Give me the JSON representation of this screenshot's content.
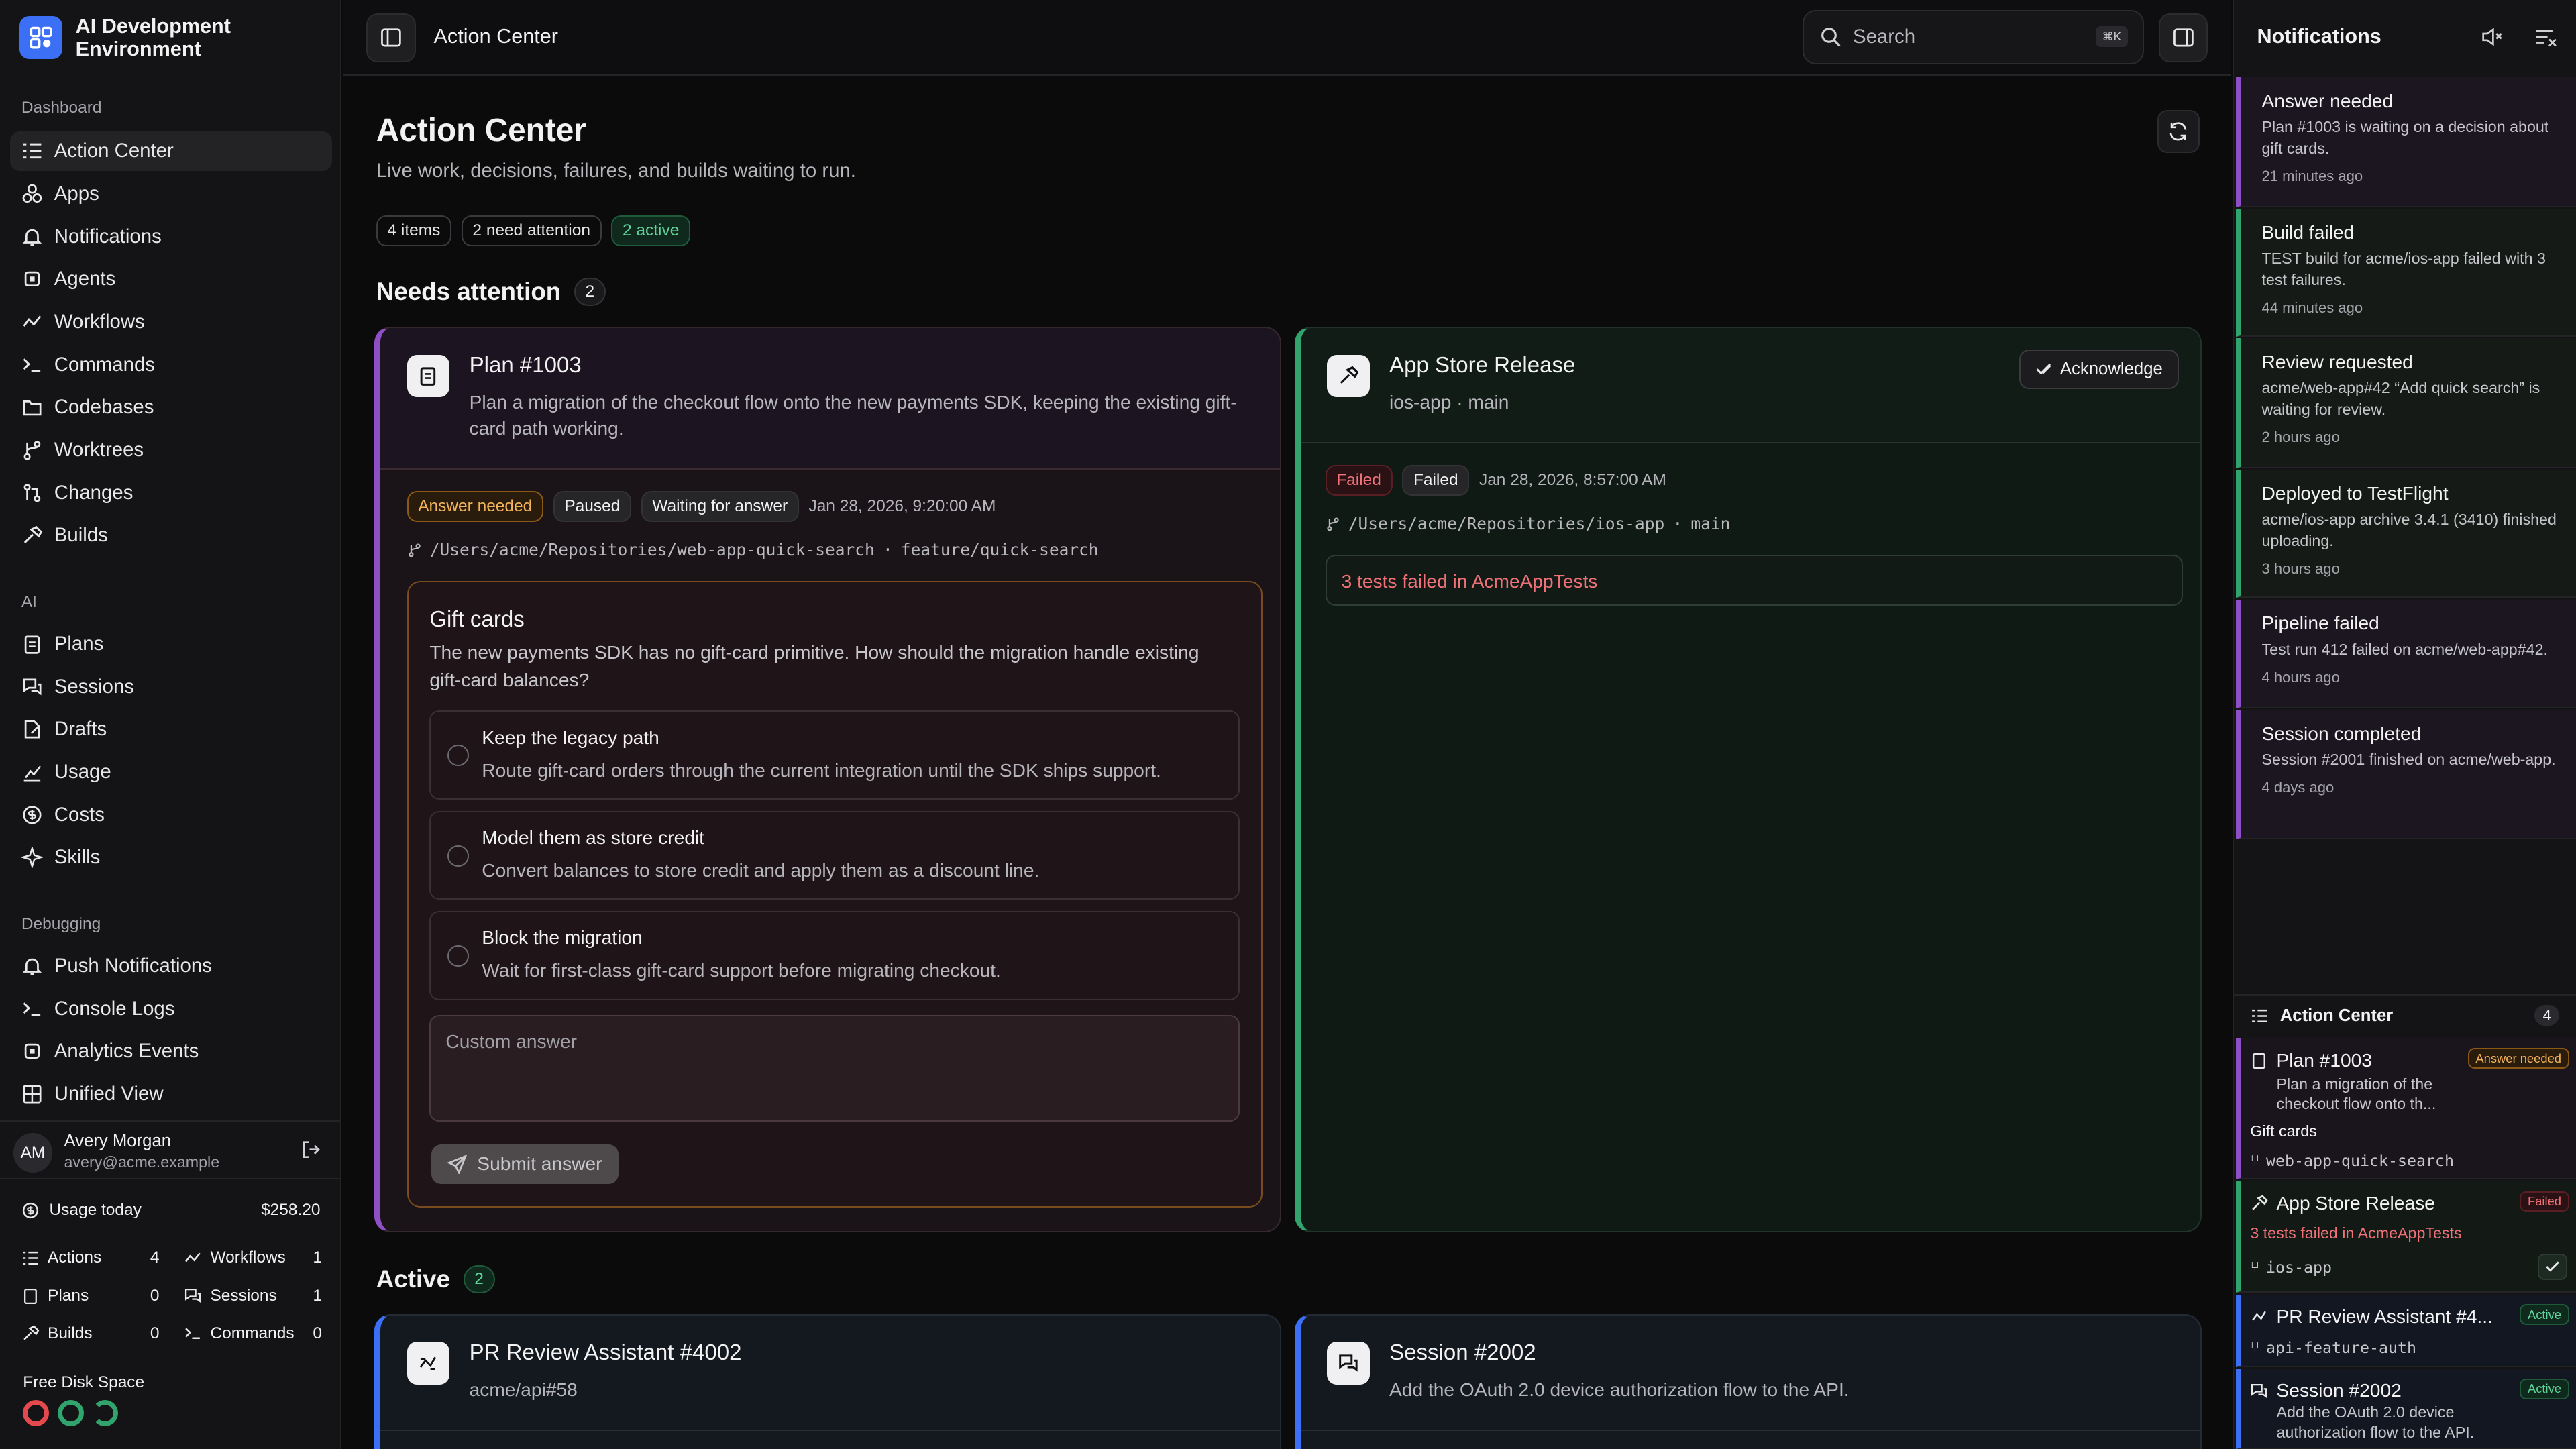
{
  "app": {
    "name": "AI Development Environment"
  },
  "sidebar": {
    "sections": [
      {
        "label": "Dashboard",
        "items": [
          {
            "label": "Action Center",
            "icon": "list-icon"
          },
          {
            "label": "Apps",
            "icon": "apps-icon"
          },
          {
            "label": "Notifications",
            "icon": "bell-icon"
          },
          {
            "label": "Agents",
            "icon": "cpu-icon"
          },
          {
            "label": "Workflows",
            "icon": "workflow-icon"
          },
          {
            "label": "Commands",
            "icon": "terminal-icon"
          },
          {
            "label": "Codebases",
            "icon": "folder-icon"
          },
          {
            "label": "Worktrees",
            "icon": "branch-icon"
          },
          {
            "label": "Changes",
            "icon": "diff-icon"
          },
          {
            "label": "Builds",
            "icon": "hammer-icon"
          }
        ]
      },
      {
        "label": "AI",
        "items": [
          {
            "label": "Plans",
            "icon": "clipboard-icon"
          },
          {
            "label": "Sessions",
            "icon": "chat-icon"
          },
          {
            "label": "Drafts",
            "icon": "draft-icon"
          },
          {
            "label": "Usage",
            "icon": "chart-icon"
          },
          {
            "label": "Costs",
            "icon": "dollar-icon"
          },
          {
            "label": "Skills",
            "icon": "sparkle-icon"
          }
        ]
      },
      {
        "label": "Debugging",
        "items": [
          {
            "label": "Push Notifications",
            "icon": "bell-icon"
          },
          {
            "label": "Console Logs",
            "icon": "terminal-icon"
          },
          {
            "label": "Analytics Events",
            "icon": "cpu-icon"
          },
          {
            "label": "Unified View",
            "icon": "list-icon"
          }
        ]
      }
    ],
    "user": {
      "initials": "AM",
      "name": "Avery Morgan",
      "email": "avery@acme.example"
    },
    "usage": {
      "label": "Usage today",
      "amount": "$258.20"
    },
    "stats": [
      {
        "label": "Actions",
        "value": "4"
      },
      {
        "label": "Workflows",
        "value": "1"
      },
      {
        "label": "Plans",
        "value": "0"
      },
      {
        "label": "Sessions",
        "value": "1"
      },
      {
        "label": "Builds",
        "value": "0"
      },
      {
        "label": "Commands",
        "value": "0"
      }
    ],
    "disk": {
      "label": "Free Disk Space",
      "rings": [
        "#e5484d",
        "#30a46c",
        "#30a46c"
      ]
    }
  },
  "topbar": {
    "breadcrumb": "Action Center",
    "search_placeholder": "Search",
    "search_shortcut": "⌘K"
  },
  "page": {
    "title": "Action Center",
    "subtitle": "Live work, decisions, failures, and builds waiting to run.",
    "chips": [
      "4 items",
      "2 need attention",
      "2 active"
    ],
    "needs_attention": {
      "label": "Needs attention",
      "count": "2"
    },
    "active": {
      "label": "Active",
      "count": "2"
    }
  },
  "plan_card": {
    "title": "Plan #1003",
    "description": "Plan a migration of the checkout flow onto the new payments SDK, keeping the existing gift-card path working.",
    "badges": [
      "Answer needed",
      "Paused",
      "Waiting for answer"
    ],
    "date": "Jan 28, 2026, 9:20:00 AM",
    "path": "/Users/acme/Repositories/web-app-quick-search",
    "branch": "feature/quick-search",
    "question": {
      "title": "Gift cards",
      "text": "The new payments SDK has no gift-card primitive. How should the migration handle existing gift-card balances?",
      "options": [
        {
          "title": "Keep the legacy path",
          "desc": "Route gift-card orders through the current integration until the SDK ships support."
        },
        {
          "title": "Model them as store credit",
          "desc": "Convert balances to store credit and apply them as a discount line."
        },
        {
          "title": "Block the migration",
          "desc": "Wait for first-class gift-card support before migrating checkout."
        }
      ],
      "custom_placeholder": "Custom answer",
      "submit": "Submit answer"
    }
  },
  "release_card": {
    "title": "App Store Release",
    "subtitle": "ios-app · main",
    "ack": "Acknowledge",
    "badges": [
      "Failed",
      "Failed"
    ],
    "date": "Jan 28, 2026, 8:57:00 AM",
    "path": "/Users/acme/Repositories/ios-app",
    "branch": "main",
    "failure": "3 tests failed in AcmeAppTests"
  },
  "active_cards": [
    {
      "title": "PR Review Assistant #4002",
      "subtitle": "acme/api#58"
    },
    {
      "title": "Session #2002",
      "subtitle": "Add the OAuth 2.0 device authorization flow to the API."
    }
  ],
  "notifications": {
    "title": "Notifications",
    "items": [
      {
        "title": "Answer needed",
        "desc": "Plan #1003 is waiting on a decision about gift cards.",
        "time": "21 minutes ago",
        "color": "#8e4ec6"
      },
      {
        "title": "Build failed",
        "desc": "TEST build for acme/ios-app failed with 3 test failures.",
        "time": "44 minutes ago",
        "color": "#30a46c"
      },
      {
        "title": "Review requested",
        "desc": "acme/web-app#42 “Add quick search” is waiting for review.",
        "time": "2 hours ago",
        "color": "#30a46c"
      },
      {
        "title": "Deployed to TestFlight",
        "desc": "acme/ios-app archive 3.4.1 (3410) finished uploading.",
        "time": "3 hours ago",
        "color": "#30a46c"
      },
      {
        "title": "Pipeline failed",
        "desc": "Test run 412 failed on acme/web-app#42.",
        "time": "4 hours ago",
        "color": "#8e4ec6"
      },
      {
        "title": "Session completed",
        "desc": "Session #2001 finished on acme/web-app.",
        "time": "4 days ago",
        "color": "#8e4ec6"
      }
    ],
    "action_center": {
      "label": "Action Center",
      "count": "4",
      "plan": {
        "title": "Plan #1003",
        "badge": "Answer needed",
        "desc": "Plan a migration of the checkout flow onto th...",
        "sub": "Gift cards",
        "path": "web-app-quick-search"
      },
      "release": {
        "title": "App Store Release",
        "badge": "Failed",
        "fail": "3 tests failed in AcmeAppTests",
        "path": "ios-app"
      },
      "pr": {
        "title": "PR Review Assistant #4...",
        "badge": "Active",
        "path": "api-feature-auth"
      },
      "session": {
        "title": "Session #2002",
        "badge": "Active",
        "desc": "Add the OAuth 2.0 device authorization flow to the API."
      }
    }
  }
}
